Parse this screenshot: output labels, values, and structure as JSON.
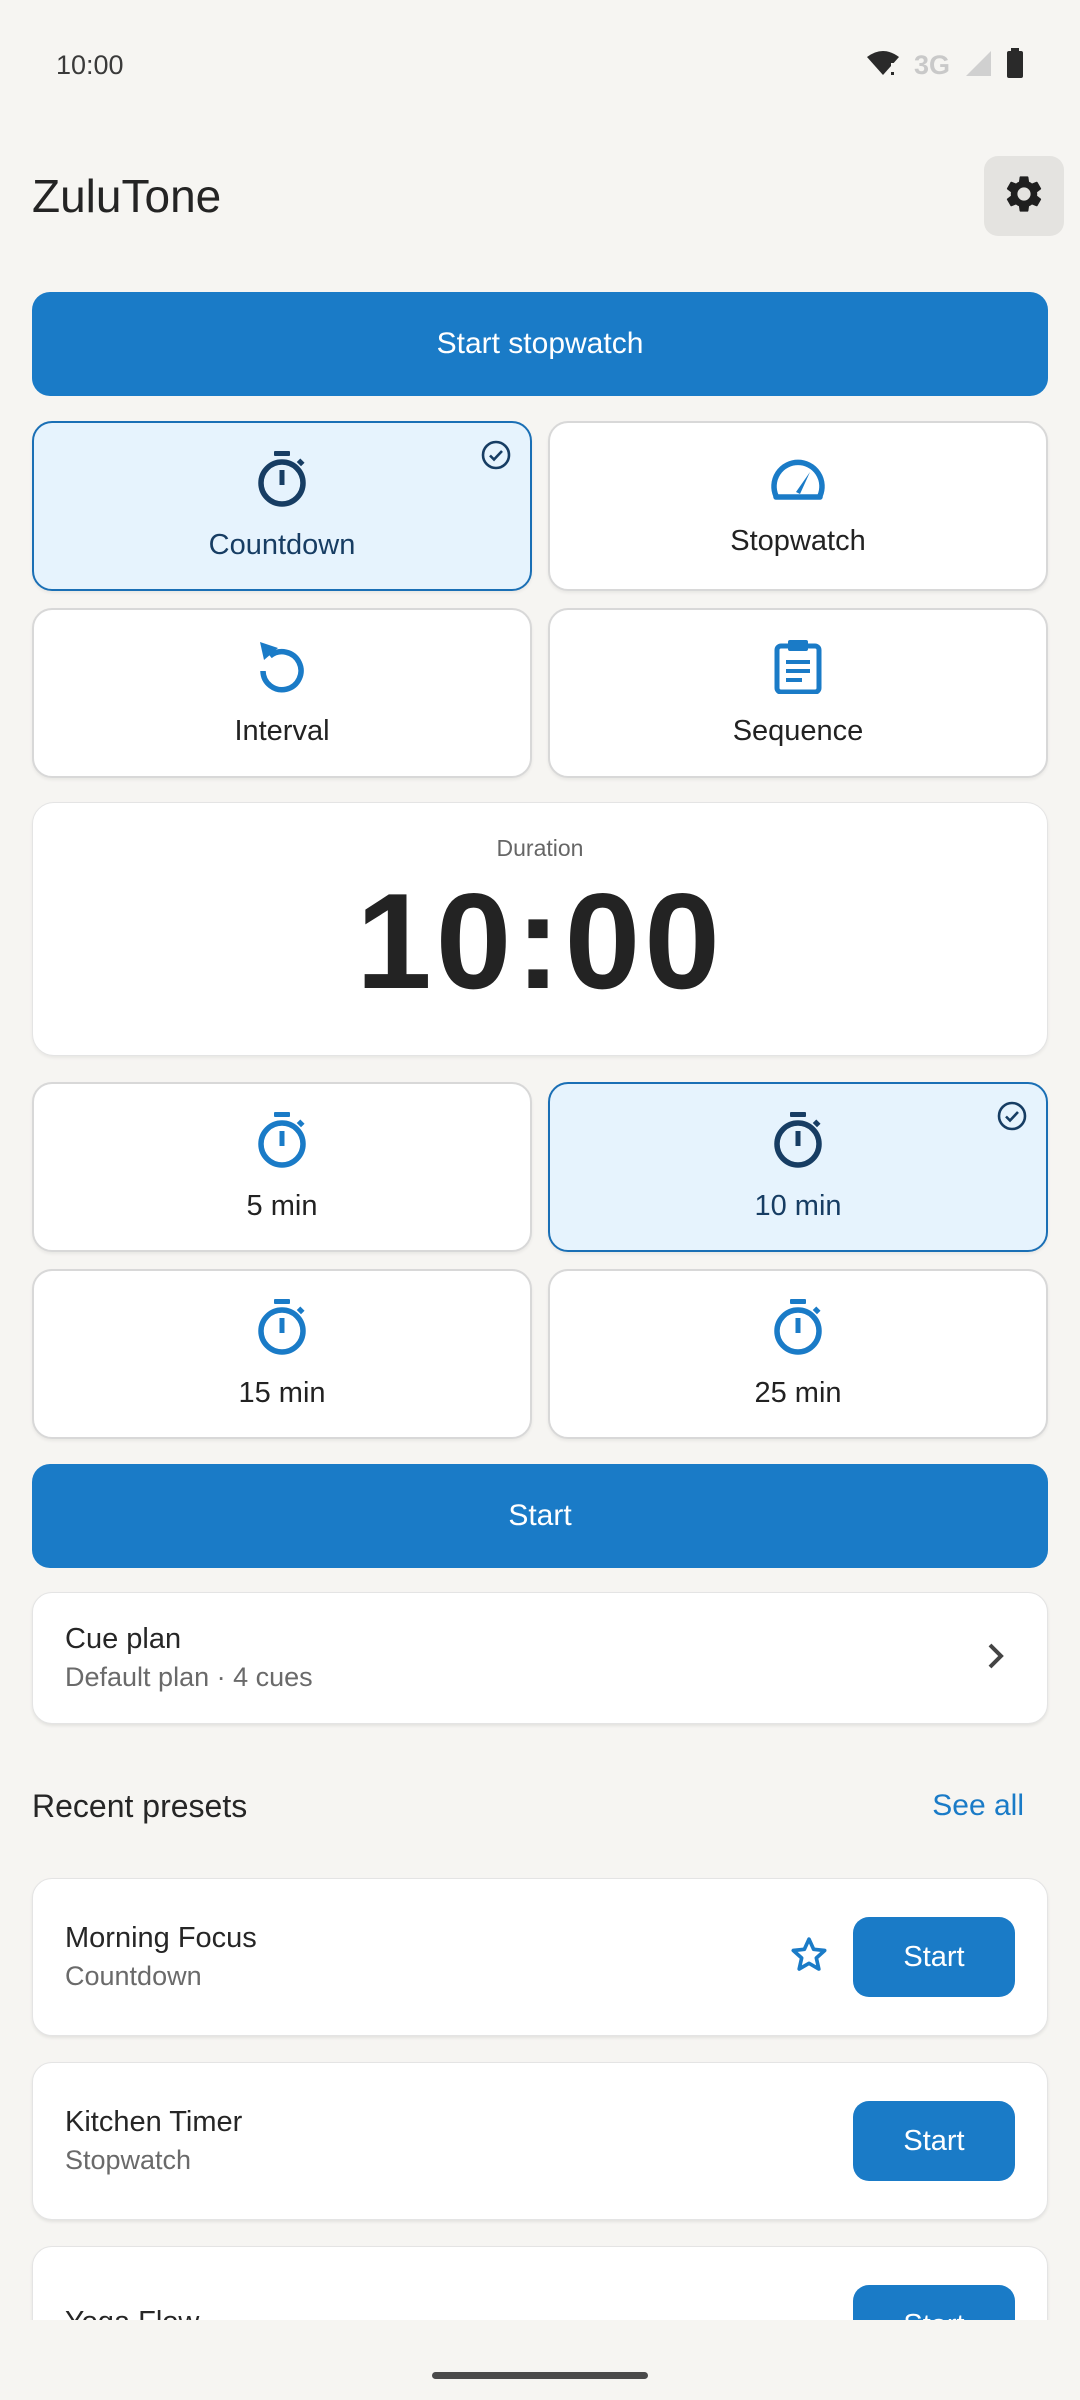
{
  "status": {
    "time": "10:00",
    "network": "3G"
  },
  "app": {
    "title": "ZuluTone"
  },
  "actions": {
    "start_stopwatch": "Start stopwatch",
    "start": "Start"
  },
  "modes": [
    {
      "label": "Countdown",
      "icon": "timer-icon",
      "selected": true
    },
    {
      "label": "Stopwatch",
      "icon": "speedometer-icon",
      "selected": false
    },
    {
      "label": "Interval",
      "icon": "replay-icon",
      "selected": false
    },
    {
      "label": "Sequence",
      "icon": "clipboard-icon",
      "selected": false
    }
  ],
  "duration": {
    "label": "Duration",
    "value": "10:00"
  },
  "quick_durations": [
    {
      "label": "5 min",
      "selected": false
    },
    {
      "label": "10 min",
      "selected": true
    },
    {
      "label": "15 min",
      "selected": false
    },
    {
      "label": "25 min",
      "selected": false
    }
  ],
  "cue_plan": {
    "title": "Cue plan",
    "subtitle": "Default plan · 4 cues"
  },
  "recent": {
    "title": "Recent presets",
    "see_all": "See all",
    "presets": [
      {
        "name": "Morning Focus",
        "type": "Countdown",
        "starred": true,
        "action": "Start"
      },
      {
        "name": "Kitchen Timer",
        "type": "Stopwatch",
        "starred": false,
        "action": "Start"
      },
      {
        "name": "Yoga Flow",
        "type": "",
        "starred": false,
        "action": "Start"
      }
    ]
  },
  "colors": {
    "accent": "#1a7bc7",
    "selected_bg": "#e6f3fd",
    "background": "#f6f5f2"
  }
}
